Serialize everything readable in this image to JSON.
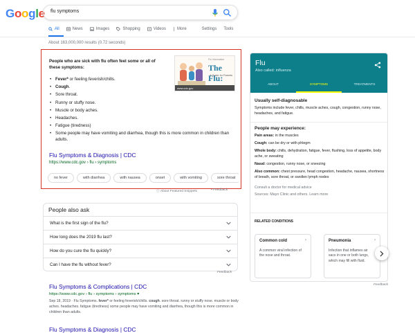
{
  "logo": {
    "letters": [
      "G",
      "o",
      "o",
      "g",
      "l",
      "e"
    ],
    "colors": [
      "#4285f4",
      "#ea4335",
      "#fbbc05",
      "#4285f4",
      "#34a853",
      "#ea4335"
    ]
  },
  "search": {
    "query": "flu symptoms"
  },
  "tabs": [
    {
      "label": "All",
      "icon": "search-icon",
      "active": true
    },
    {
      "label": "News",
      "icon": "news-icon"
    },
    {
      "label": "Images",
      "icon": "image-icon"
    },
    {
      "label": "Shopping",
      "icon": "tag-icon"
    },
    {
      "label": "Videos",
      "icon": "video-icon"
    },
    {
      "label": "More",
      "icon": "more-icon"
    },
    {
      "label": "Settings"
    },
    {
      "label": "Tools"
    }
  ],
  "result_stats": "About 163,000,000 results (0.72 seconds)",
  "snippet": {
    "lead": "People who are sick with flu often feel some or all of these symptoms:",
    "items": [
      {
        "bold": "Fever*",
        "rest": " or feeling feverish/chills."
      },
      {
        "bold": "Cough",
        "rest": "."
      },
      {
        "bold": "",
        "rest": "Sore throat."
      },
      {
        "bold": "",
        "rest": "Runny or stuffy nose."
      },
      {
        "bold": "",
        "rest": "Muscle or body aches."
      },
      {
        "bold": "",
        "rest": "Headaches."
      },
      {
        "bold": "",
        "rest": "Fatigue (tiredness)"
      },
      {
        "bold": "",
        "rest": "Some people may have vomiting and diarrhea, though this is more common in children than adults."
      }
    ],
    "thumb": {
      "top": "Flu Information",
      "title": "The Flu:",
      "sub": "A Guide for Parents",
      "footer": "www.cdc.gov"
    },
    "link_title": "Flu Symptoms & Diagnosis | CDC",
    "link_url": "https://www.cdc.gov › flu › symptoms",
    "chips": [
      "no fever",
      "with diarrhea",
      "with nausea",
      "onset",
      "with vomiting",
      "sore throat",
      "he"
    ],
    "about": "About Featured Snippets",
    "feedback": "Feedback"
  },
  "paa": {
    "title": "People also ask",
    "questions": [
      "What is the first sign of the flu?",
      "How long does the 2019 flu last?",
      "How do you cure the flu quickly?",
      "Can I have the flu without fever?"
    ],
    "feedback": "Feedback"
  },
  "results": [
    {
      "title": "Flu Symptoms & Complications | CDC",
      "url": "https://www.cdc.gov › flu › symptoms › symptoms ▾",
      "date": "Sep 18, 2019 · Flu Symptoms. ",
      "desc_b1": "fever*",
      "desc_m1": " or feeling feverish/chills. ",
      "desc_b2": "cough",
      "desc_m2": ". sore throat. runny or stuffy nose. muscle or body aches. headaches. fatigue (tiredness) some people may have vomiting and diarrhea, though this is more common in children than adults."
    },
    {
      "title": "Flu Symptoms & Diagnosis | CDC"
    }
  ],
  "knowledge_panel": {
    "title": "Flu",
    "subtitle": "Also called: influenza",
    "tabs": [
      "ABOUT",
      "SYMPTOMS",
      "TREATMENTS"
    ],
    "active_tab": 1,
    "accent": "#0c7f8b",
    "h1": "Usually self-diagnosable",
    "p1": "Symptoms include fever, chills, muscle aches, cough, congestion, runny nose, headaches, and fatigue.",
    "h2": "People may experience:",
    "experience": [
      {
        "label": "Pain areas:",
        "text": " in the muscles"
      },
      {
        "label": "Cough:",
        "text": " can be dry or with phlegm"
      },
      {
        "label": "Whole body:",
        "text": " chills, dehydration, fatigue, fever, flushing, loss of appetite, body ache, or sweating"
      },
      {
        "label": "Nasal:",
        "text": " congestion, runny nose, or sneezing"
      },
      {
        "label": "Also common:",
        "text": " chest pressure, head congestion, headache, nausea, shortness of breath, sore throat, or swollen lymph nodes"
      }
    ],
    "consult": "Consult a doctor for medical advice",
    "sources": "Sources: Mayo Clinic and others. Learn more",
    "related_title": "RELATED CONDITIONS",
    "related": [
      {
        "title": "Common cold",
        "desc": "A common viral infection of the nose and throat."
      },
      {
        "title": "Pneumonia",
        "desc": "Infection that inflames air sacs in one or both lungs, which may fill with fluid."
      }
    ],
    "feedback": "Feedback"
  }
}
